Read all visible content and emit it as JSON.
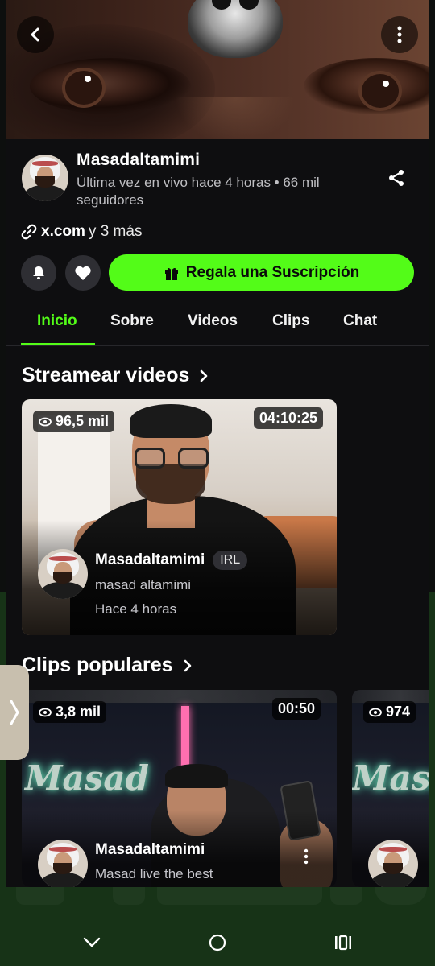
{
  "header": {
    "back_icon": "chevron-left-icon",
    "more_icon": "vertical-dots-icon"
  },
  "profile": {
    "channel_name": "Masadaltamimi",
    "last_live": "Última vez en vivo hace 4 horas • 66 mil seguidores",
    "share_icon": "share-icon",
    "link_domain": "x.com",
    "link_more": "y 3 más"
  },
  "actions": {
    "bell_icon": "bell-icon",
    "heart_icon": "heart-icon",
    "gift_label": "Regala una Suscripción",
    "gift_icon": "gift-icon"
  },
  "tabs": [
    {
      "label": "Inicio",
      "active": true
    },
    {
      "label": "Sobre",
      "active": false
    },
    {
      "label": "Videos",
      "active": false
    },
    {
      "label": "Clips",
      "active": false
    },
    {
      "label": "Chat",
      "active": false
    }
  ],
  "stream_videos": {
    "title": "Streamear videos",
    "items": [
      {
        "views": "96,5 mil",
        "duration": "04:10:25",
        "channel": "Masadaltamimi",
        "tag": "IRL",
        "title": "masad altamimi",
        "time": "Hace 4 horas"
      }
    ]
  },
  "popular_clips": {
    "title": "Clips populares",
    "items": [
      {
        "views": "3,8 mil",
        "duration": "00:50",
        "channel": "Masadaltamimi",
        "title": "Masad live the best",
        "neon_text": "Masad"
      },
      {
        "views": "974",
        "neon_text": "Masa"
      }
    ]
  },
  "colors": {
    "accent": "#53fc18",
    "app_bg": "#0e0e10",
    "outer_bg": "#173317"
  },
  "system_nav": {
    "back_icon": "nav-back-chevron-icon",
    "home_icon": "nav-home-circle-icon",
    "recents_icon": "nav-recents-icon"
  }
}
